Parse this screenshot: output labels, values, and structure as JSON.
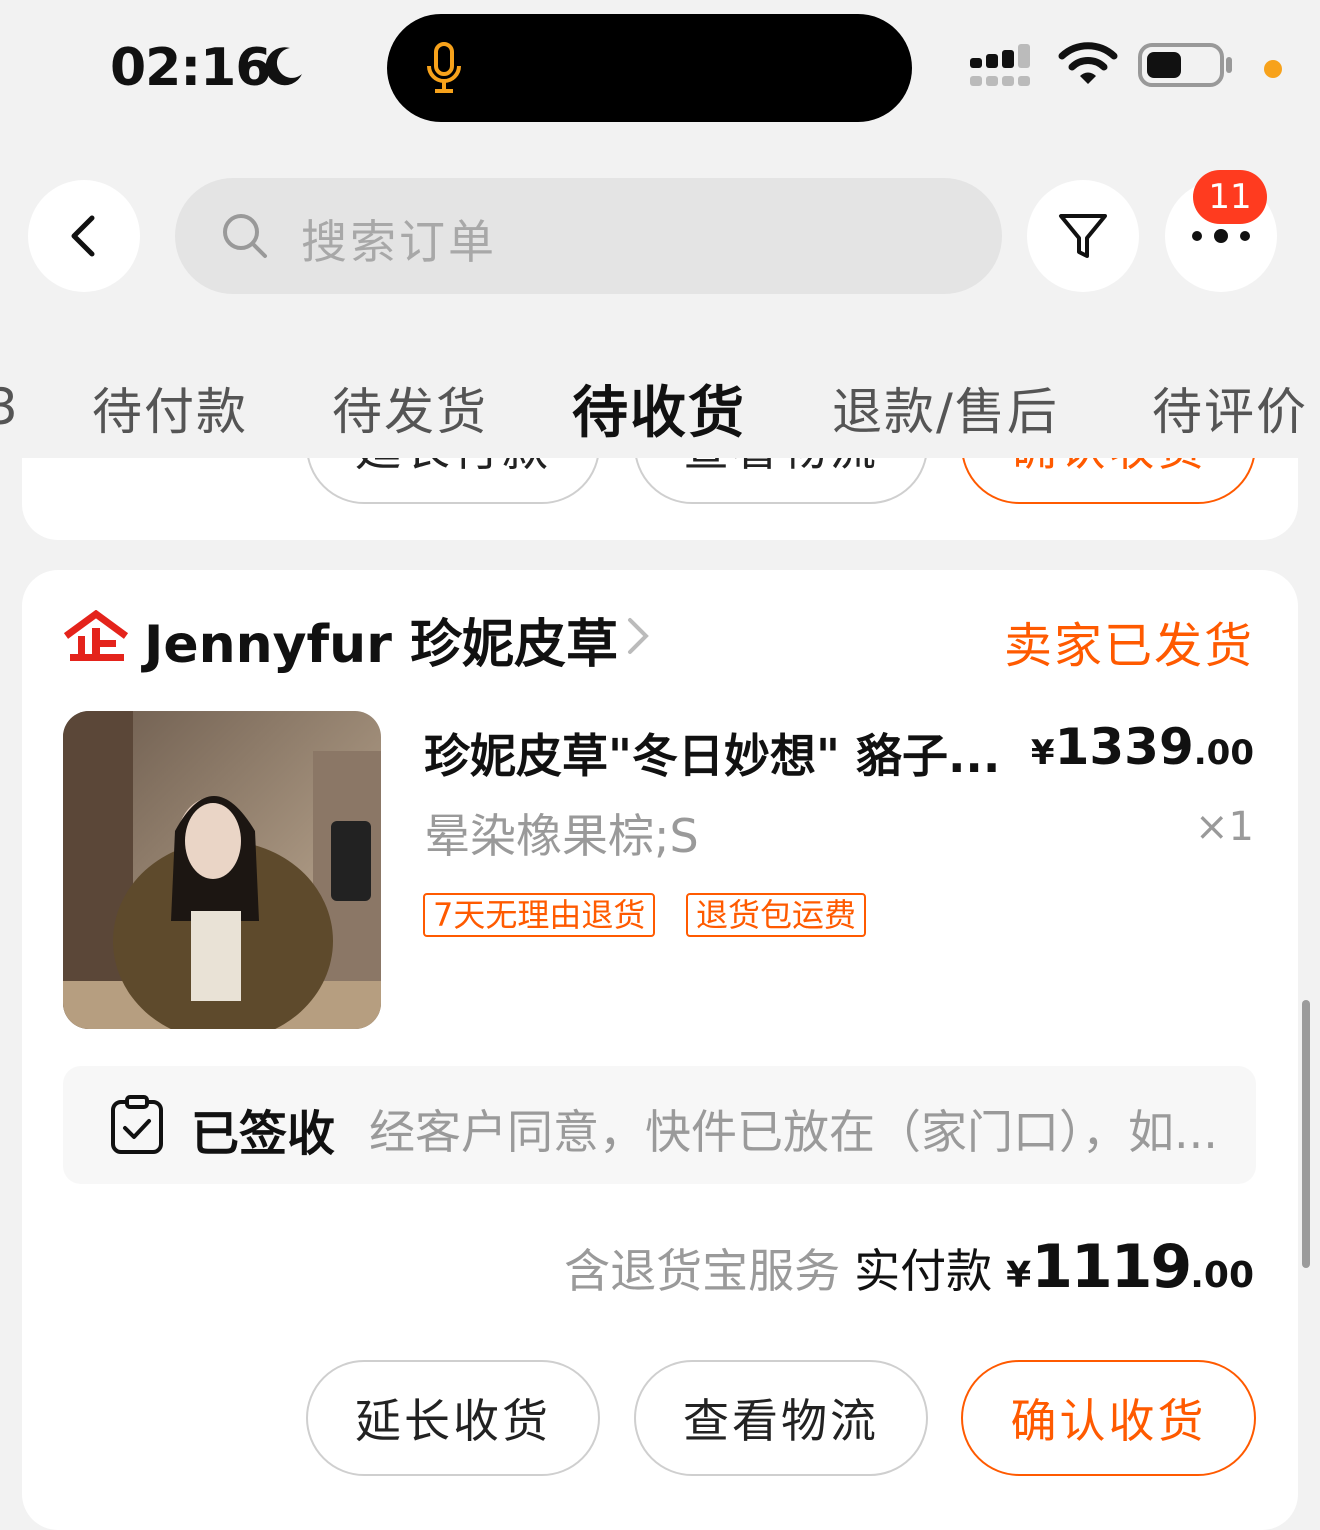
{
  "status_bar": {
    "time": "02:16",
    "battery_color": "#111111",
    "dot_color": "#f7a21b"
  },
  "header": {
    "search_placeholder": "搜索订单",
    "notification_count": "11"
  },
  "tabs": [
    {
      "label": "待付款",
      "active": false
    },
    {
      "label": "待发货",
      "active": false
    },
    {
      "label": "待收货",
      "active": true
    },
    {
      "label": "退款/售后",
      "active": false
    },
    {
      "label": "待评价",
      "active": false
    }
  ],
  "previous_card": {
    "buttons": [
      "延长付款",
      "查看物流",
      "确认收货"
    ]
  },
  "order": {
    "shop_name": "Jennyfur 珍妮皮草",
    "status": "卖家已发货",
    "product": {
      "title": "珍妮皮草\"冬日妙想\" 貉子...",
      "price_symbol": "¥",
      "price_int": "1339",
      "price_dec": ".00",
      "variant": "晕染橡果棕;S",
      "quantity": "×1",
      "tags": [
        "7天无理由退货",
        "退货包运费"
      ]
    },
    "logistics": {
      "status": "已签收",
      "desc": "经客户同意，快件已放在（家门口），如..."
    },
    "payment": {
      "note": "含退货宝服务",
      "label": "实付款",
      "symbol": "¥",
      "int": "1119",
      "dec": ".00"
    },
    "buttons": {
      "extend": "延长收货",
      "logistics": "查看物流",
      "confirm": "确认收货"
    }
  },
  "colors": {
    "accent": "#ff5a00",
    "badge": "#ff3b1f",
    "brand_red": "#e4231b"
  }
}
